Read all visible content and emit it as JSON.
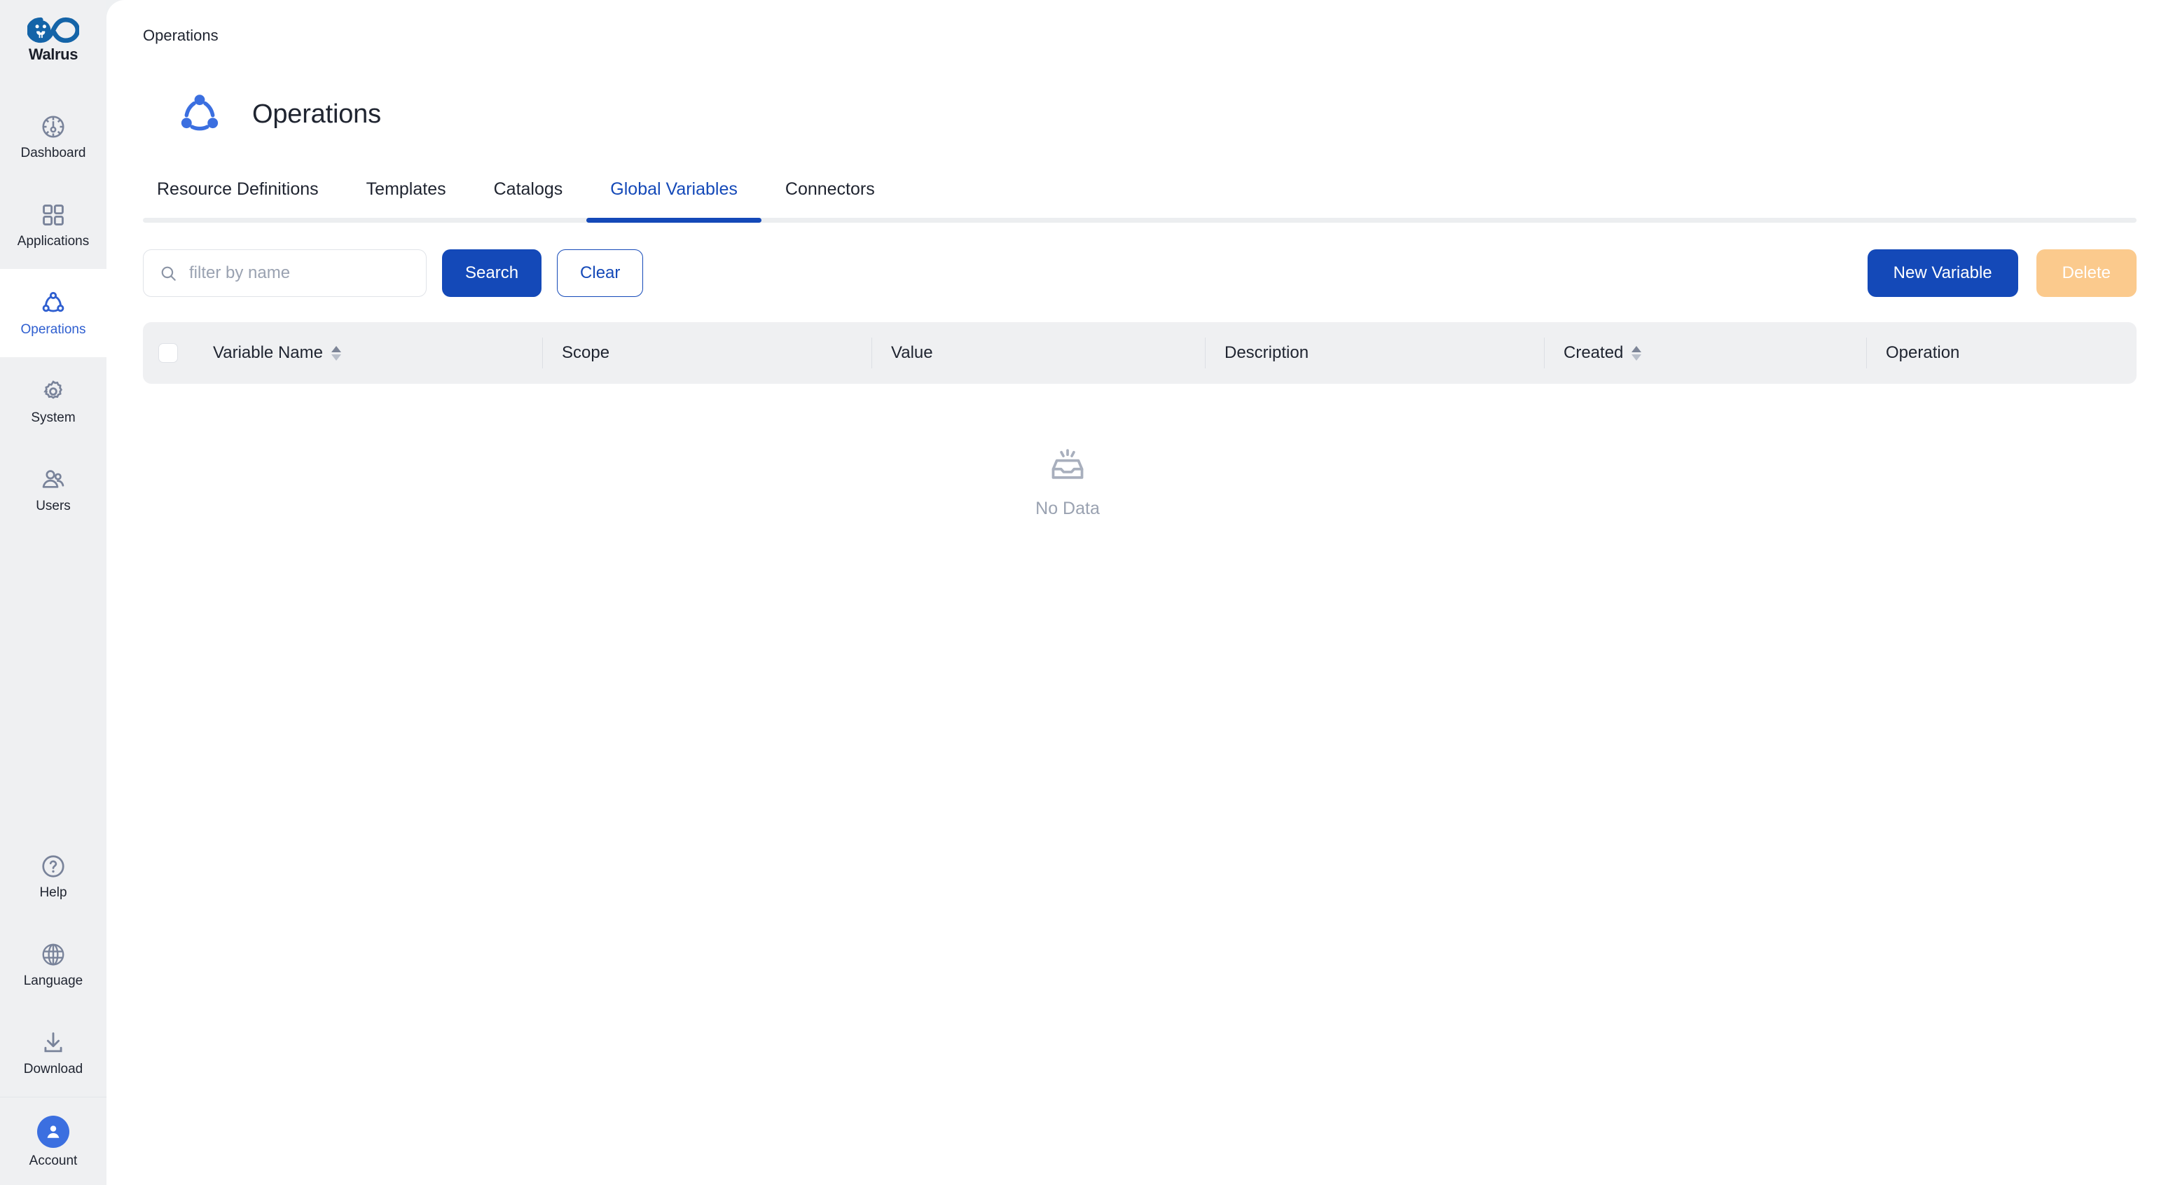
{
  "brand": {
    "name": "Walrus",
    "logo_icon": "walrus-infinity-logo"
  },
  "sidebar": {
    "items": [
      {
        "label": "Dashboard",
        "icon": "dashboard-gauge-icon",
        "active": false
      },
      {
        "label": "Applications",
        "icon": "grid-apps-icon",
        "active": false
      },
      {
        "label": "Operations",
        "icon": "operations-nodes-icon",
        "active": true
      },
      {
        "label": "System",
        "icon": "gear-icon",
        "active": false
      },
      {
        "label": "Users",
        "icon": "users-icon",
        "active": false
      }
    ],
    "bottom_items": [
      {
        "label": "Help",
        "icon": "question-circle-icon"
      },
      {
        "label": "Language",
        "icon": "globe-icon"
      },
      {
        "label": "Download",
        "icon": "download-icon"
      }
    ],
    "account": {
      "label": "Account",
      "icon": "avatar-person-icon"
    }
  },
  "breadcrumb": "Operations",
  "page": {
    "title": "Operations",
    "icon": "operations-nodes-icon"
  },
  "tabs": [
    {
      "label": "Resource Definitions",
      "active": false
    },
    {
      "label": "Templates",
      "active": false
    },
    {
      "label": "Catalogs",
      "active": false
    },
    {
      "label": "Global Variables",
      "active": true
    },
    {
      "label": "Connectors",
      "active": false
    }
  ],
  "toolbar": {
    "search_placeholder": "filter by name",
    "search_value": "",
    "search_icon": "search-icon",
    "search_label": "Search",
    "clear_label": "Clear",
    "new_variable_label": "New Variable",
    "delete_label": "Delete"
  },
  "table": {
    "columns": [
      {
        "label": "Variable Name",
        "sortable": true
      },
      {
        "label": "Scope",
        "sortable": false
      },
      {
        "label": "Value",
        "sortable": false
      },
      {
        "label": "Description",
        "sortable": false
      },
      {
        "label": "Created",
        "sortable": true
      },
      {
        "label": "Operation",
        "sortable": false
      }
    ],
    "rows": [],
    "empty_text": "No Data",
    "empty_icon": "empty-inbox-icon"
  },
  "colors": {
    "accent_blue": "#1449b8",
    "nav_blue": "#2f5fd0",
    "sidebar_bg": "#eff0f2",
    "disabled_orange": "#fbca8d",
    "muted_text": "#9aa2b1"
  }
}
